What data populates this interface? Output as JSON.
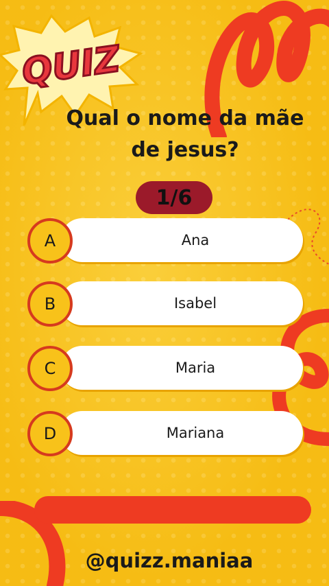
{
  "logo": {
    "text": "QUIZ"
  },
  "question": "Qual o nome da mãe de jesus?",
  "counter": "1/6",
  "options": [
    {
      "letter": "A",
      "text": "Ana"
    },
    {
      "letter": "B",
      "text": "Isabel"
    },
    {
      "letter": "C",
      "text": "Maria"
    },
    {
      "letter": "D",
      "text": "Mariana"
    }
  ],
  "progress": 0,
  "handle": "@quizz.maniaa",
  "colors": {
    "background": "#f8c21a",
    "accent_red": "#ee3b22",
    "counter_bg": "#9b1a2a",
    "option_bg": "#ffffff"
  }
}
